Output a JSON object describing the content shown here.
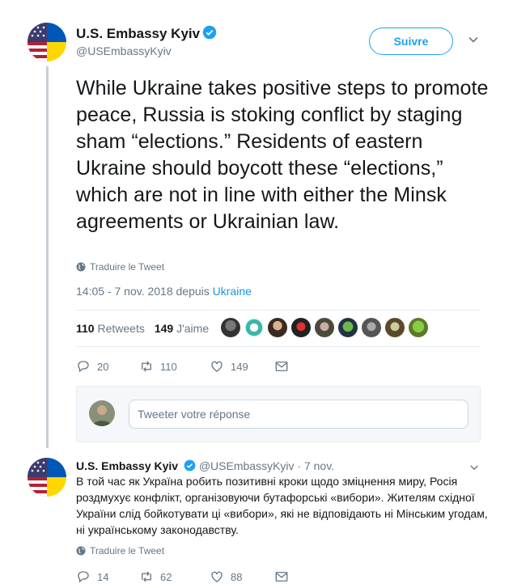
{
  "tweet": {
    "author_name": "U.S. Embassy Kyiv",
    "author_handle": "@USEmbassyKyiv",
    "follow_label": "Suivre",
    "text": "While Ukraine takes positive steps to promote peace, Russia is stoking conflict by staging sham “elections.” Residents of eastern Ukraine should boycott these “elections,” which are not in line with either the Minsk agreements or Ukrainian law.",
    "translate_label": "Traduire le Tweet",
    "timestamp": "14:05 - 7 nov. 2018 depuis ",
    "location": "Ukraine",
    "retweets_count": "110",
    "retweets_label": "Retweets",
    "likes_count": "149",
    "likes_label": "J'aime",
    "actions": {
      "replies": "20",
      "retweets": "110",
      "likes": "149"
    }
  },
  "reply": {
    "placeholder": "Tweeter votre réponse"
  },
  "second_tweet": {
    "author_name": "U.S. Embassy Kyiv",
    "meta": "@USEmbassyKyiv · 7 nov.",
    "text": "В той час як Україна робить позитивні кроки щодо зміцнення миру, Росія роздмухує конфлікт, організовуючи бутафорські «вибори». Жителям східної України слід бойкотувати ці «вибори», які не відповідають ні Мінським угодам, ні українському законодавству.",
    "translate_label": "Traduire le Tweet",
    "actions": {
      "replies": "14",
      "retweets": "62",
      "likes": "88"
    }
  },
  "colors": {
    "accent": "#1da1f2",
    "link": "#1b95e0",
    "muted": "#657786"
  }
}
